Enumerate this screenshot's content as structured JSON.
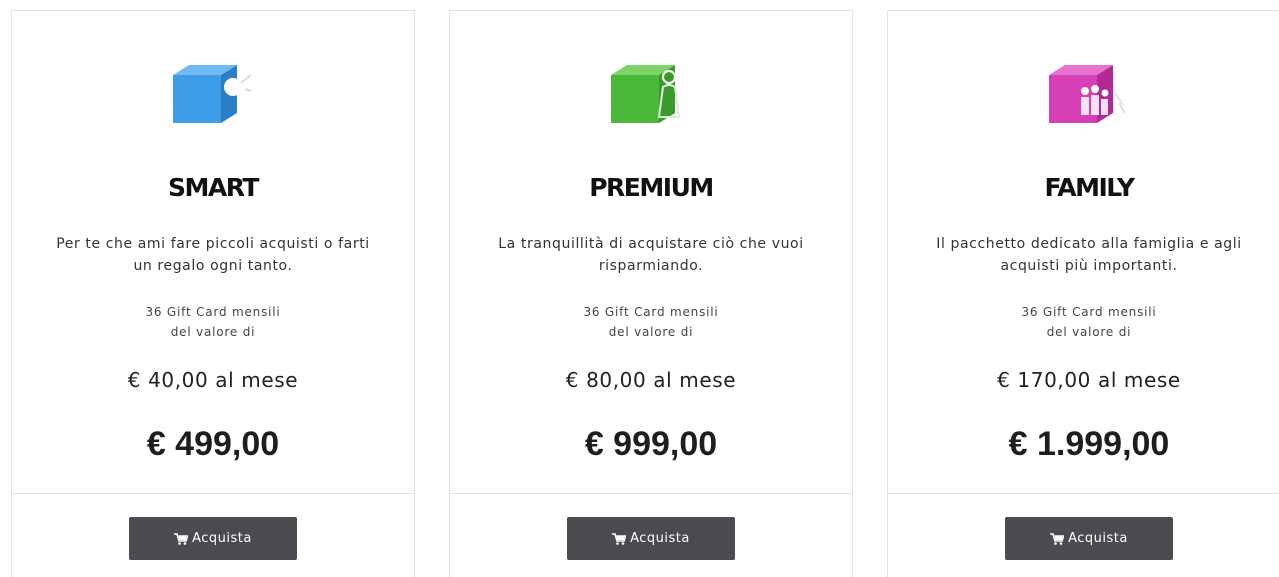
{
  "plans": [
    {
      "name": "SMART",
      "color": "#3d9de8",
      "description_line1": "Per te che ami fare piccoli acquisti o farti",
      "description_line2": "un regalo ogni tanto.",
      "gift_line1": "36 Gift Card mensili",
      "gift_line2": "del valore di",
      "monthly": "€ 40,00 al mese",
      "price": "€ 499,00",
      "button_label": "Acquista",
      "button_icon": "cart-icon"
    },
    {
      "name": "PREMIUM",
      "color": "#4cb83a",
      "description_line1": "La tranquillità  di acquistare ciò che vuoi",
      "description_line2": "risparmiando.",
      "gift_line1": "36 Gift Card mensili",
      "gift_line2": "del valore di",
      "monthly": "€ 80,00 al mese",
      "price": "€ 999,00",
      "button_label": "Acquista",
      "button_icon": "cart-icon"
    },
    {
      "name": "FAMILY",
      "color": "#d63fb6",
      "description_line1": "Il pacchetto dedicato alla famiglia e agli",
      "description_line2": "acquisti più importanti.",
      "gift_line1": "36 Gift Card mensili",
      "gift_line2": "del valore di",
      "monthly": "€ 170,00 al mese",
      "price": "€ 1.999,00",
      "button_label": "Acquista",
      "button_icon": "cart-icon"
    }
  ]
}
